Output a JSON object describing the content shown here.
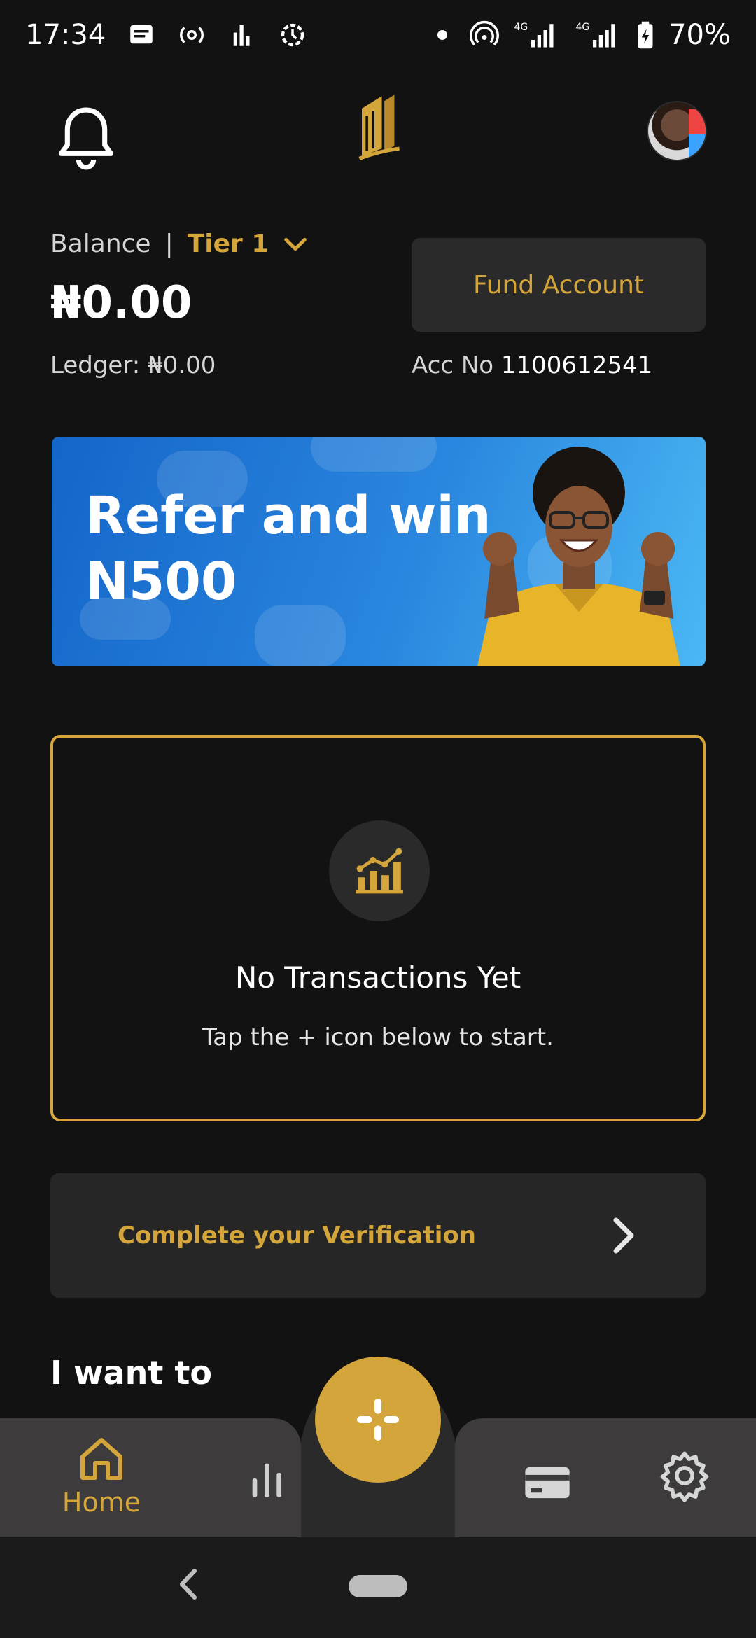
{
  "status_bar": {
    "time": "17:34",
    "battery": "70%",
    "network": "4G",
    "icons": [
      "message-icon",
      "radio-icon",
      "signal-bars-icon",
      "sync-icon",
      "dot-icon",
      "hotspot-icon",
      "cell-signal-icon",
      "battery-icon"
    ]
  },
  "header": {
    "bell_icon": "bell-icon",
    "logo_icon": "brand-logo-icon",
    "avatar_icon": "profile-avatar"
  },
  "balance": {
    "label": "Balance",
    "divider": "|",
    "tier": "Tier 1",
    "amount": "₦0.00",
    "ledger_label": "Ledger:",
    "ledger_amount": "₦0.00"
  },
  "fund_account": {
    "label": "Fund Account"
  },
  "account": {
    "label": "Acc No",
    "number": "1100612541"
  },
  "banner": {
    "line1": "Refer and win",
    "line2": "N500"
  },
  "empty_state": {
    "title": "No Transactions Yet",
    "subtitle": "Tap the + icon below to start.",
    "icon": "chart-growth-icon"
  },
  "verification": {
    "label": "Complete your Verification"
  },
  "section": {
    "title": "I want to"
  },
  "bottom_nav": {
    "home_label": "Home",
    "items": [
      "home-icon",
      "stats-icon",
      "add-icon",
      "card-icon",
      "settings-icon"
    ]
  },
  "colors": {
    "accent": "#d4a53a",
    "background": "#121212",
    "card": "#2a2a2a",
    "nav": "#3d3b3b",
    "banner_blue": "#2a86de"
  }
}
